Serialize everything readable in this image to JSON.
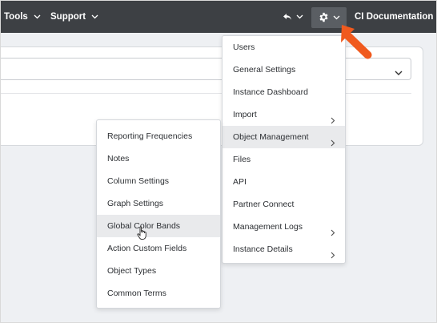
{
  "topbar": {
    "tools_label": "Tools",
    "support_label": "Support",
    "undo_icon": "undo-icon",
    "gear_icon": "gear-icon",
    "docs_label": "CI Documentation"
  },
  "settings_menu": {
    "items": [
      {
        "label": "Users",
        "submenu": false
      },
      {
        "label": "General Settings",
        "submenu": false
      },
      {
        "label": "Instance Dashboard",
        "submenu": false
      },
      {
        "label": "Import",
        "submenu": true
      },
      {
        "label": "Object Management",
        "submenu": true,
        "active": true
      },
      {
        "label": "Files",
        "submenu": false
      },
      {
        "label": "API",
        "submenu": false
      },
      {
        "label": "Partner Connect",
        "submenu": false
      },
      {
        "label": "Management Logs",
        "submenu": true
      },
      {
        "label": "Instance Details",
        "submenu": true
      }
    ]
  },
  "object_management_menu": {
    "items": [
      {
        "label": "Reporting Frequencies"
      },
      {
        "label": "Notes"
      },
      {
        "label": "Column Settings"
      },
      {
        "label": "Graph Settings"
      },
      {
        "label": "Global Color Bands",
        "hovered": true
      },
      {
        "label": "Action Custom Fields"
      },
      {
        "label": "Object Types"
      },
      {
        "label": "Common Terms"
      }
    ]
  },
  "annotation": {
    "arrow_color": "#f05a1e",
    "arrow_icon": "orange-pointer-arrow-icon"
  },
  "colors": {
    "topbar_bg": "#3d4044",
    "gear_button_bg": "#5a5e63",
    "hover_bg": "#e9eaec"
  }
}
